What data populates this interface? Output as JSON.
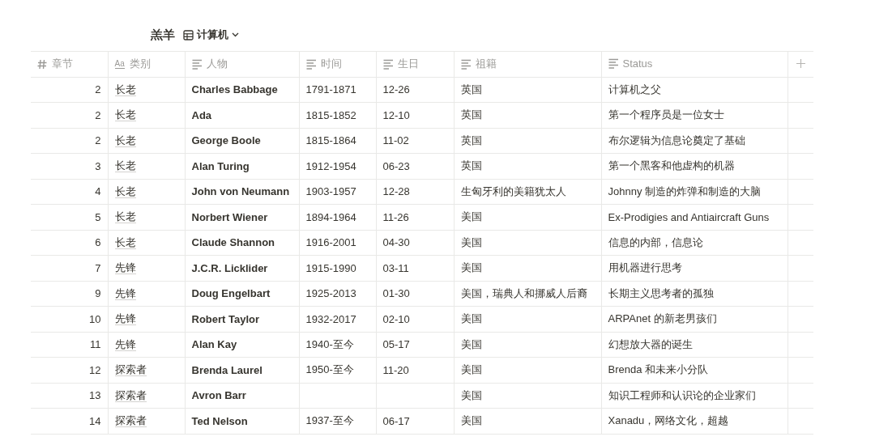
{
  "header": {
    "title": "羔羊",
    "view": {
      "label": "计算机"
    }
  },
  "table": {
    "columns": [
      {
        "label": "章节",
        "kind": "number"
      },
      {
        "label": "类别",
        "kind": "title",
        "icon_text": "Aa"
      },
      {
        "label": "人物",
        "kind": "text"
      },
      {
        "label": "时间",
        "kind": "text"
      },
      {
        "label": "生日",
        "kind": "text"
      },
      {
        "label": "祖籍",
        "kind": "text"
      },
      {
        "label": "Status",
        "kind": "text"
      }
    ],
    "rows": [
      {
        "chapter": "2",
        "category": "长老",
        "person": "Charles Babbage",
        "time": "1791-1871",
        "birthday": "12-26",
        "origin": "英国",
        "status": "计算机之父"
      },
      {
        "chapter": "2",
        "category": "长老",
        "person": "Ada",
        "time": "1815-1852",
        "birthday": "12-10",
        "origin": "英国",
        "status": "第一个程序员是一位女士"
      },
      {
        "chapter": "2",
        "category": "长老",
        "person": "George Boole",
        "time": "1815-1864",
        "birthday": "11-02",
        "origin": "英国",
        "status": "布尔逻辑为信息论奠定了基础"
      },
      {
        "chapter": "3",
        "category": "长老",
        "person": "Alan Turing",
        "time": "1912-1954",
        "birthday": "06-23",
        "origin": "英国",
        "status": "第一个黑客和他虚构的机器"
      },
      {
        "chapter": "4",
        "category": "长老",
        "person": "John von Neumann",
        "time": "1903-1957",
        "birthday": "12-28",
        "origin": "生匈牙利的美籍犹太人",
        "status": "Johnny 制造的炸弹和制造的大脑"
      },
      {
        "chapter": "5",
        "category": "长老",
        "person": "Norbert Wiener",
        "time": "1894-1964",
        "birthday": "11-26",
        "origin": "美国",
        "status": "Ex-Prodigies and Antiaircraft Guns"
      },
      {
        "chapter": "6",
        "category": "长老",
        "person": "Claude Shannon",
        "time": "1916-2001",
        "birthday": "04-30",
        "origin": "美国",
        "status": "信息的内部，信息论"
      },
      {
        "chapter": "7",
        "category": "先锋",
        "person": "J.C.R. Licklider",
        "time": "1915-1990",
        "birthday": "03-11",
        "origin": "美国",
        "status": "用机器进行思考"
      },
      {
        "chapter": "9",
        "category": "先锋",
        "person": "Doug Engelbart",
        "time": "1925-2013",
        "birthday": "01-30",
        "origin": "美国，瑞典人和挪威人后裔",
        "status": "长期主义思考者的孤独"
      },
      {
        "chapter": "10",
        "category": "先锋",
        "person": "Robert Taylor",
        "time": "1932-2017",
        "birthday": "02-10",
        "origin": "美国",
        "status": "ARPAnet 的新老男孩们"
      },
      {
        "chapter": "11",
        "category": "先锋",
        "person": "Alan Kay",
        "time": "1940-至今",
        "birthday": "05-17",
        "origin": "美国",
        "status": "幻想放大器的诞生"
      },
      {
        "chapter": "12",
        "category": "探索者",
        "person": "Brenda Laurel",
        "time": "1950-至今",
        "birthday": "11-20",
        "origin": "美国",
        "status": "Brenda 和未来小分队"
      },
      {
        "chapter": "13",
        "category": "探索者",
        "person": "Avron Barr",
        "origin": "美国",
        "status": "知识工程师和认识论的企业家们"
      },
      {
        "chapter": "14",
        "category": "探索者",
        "person": "Ted Nelson",
        "time": "1937-至今",
        "birthday": "06-17",
        "origin": "美国",
        "status": "Xanadu，网络文化，超越"
      }
    ]
  }
}
